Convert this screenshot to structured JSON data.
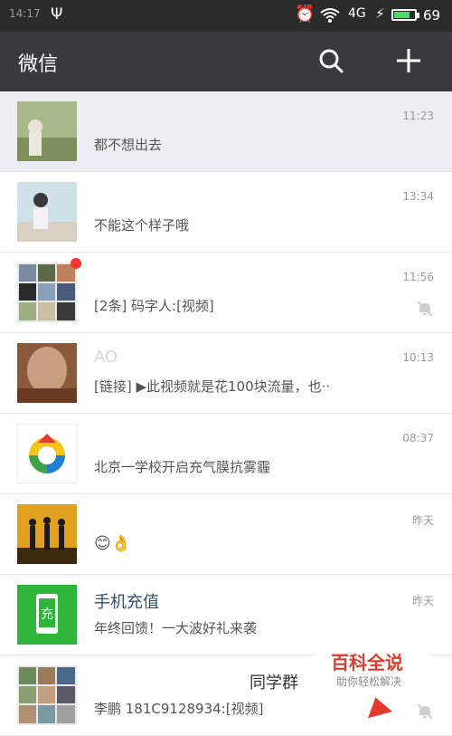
{
  "status_bar": {
    "time": "14:17",
    "battery_pct": "69",
    "signal": "4G"
  },
  "header": {
    "title": "微信"
  },
  "chats": [
    {
      "name": "",
      "preview": "都不想出去",
      "time": "11:23"
    },
    {
      "name": "",
      "preview": "不能这个样子哦",
      "time": "13:34"
    },
    {
      "name": "",
      "preview": "[2条] 码字人:[视频]",
      "time": "11:56",
      "muted": true,
      "unread_dot": true
    },
    {
      "name": "AO",
      "preview": "[链接] ▶此视频就是花100块流量，也··",
      "time": "10:13"
    },
    {
      "name": "",
      "preview": "北京一学校开启充气膜抗雾霾",
      "time": "08:37"
    },
    {
      "name": "",
      "preview": "😊👌",
      "time": "昨天"
    },
    {
      "name": "手机充值",
      "preview": "年终回馈！一大波好礼来袭",
      "time": "昨天"
    },
    {
      "name": "同学群",
      "preview": "李鹏  181C9128934:[视频]",
      "time": "",
      "muted": true
    }
  ],
  "icons": {
    "充值": "充"
  },
  "watermark": {
    "title": "百科全说",
    "subtitle": "助你轻松解决"
  }
}
